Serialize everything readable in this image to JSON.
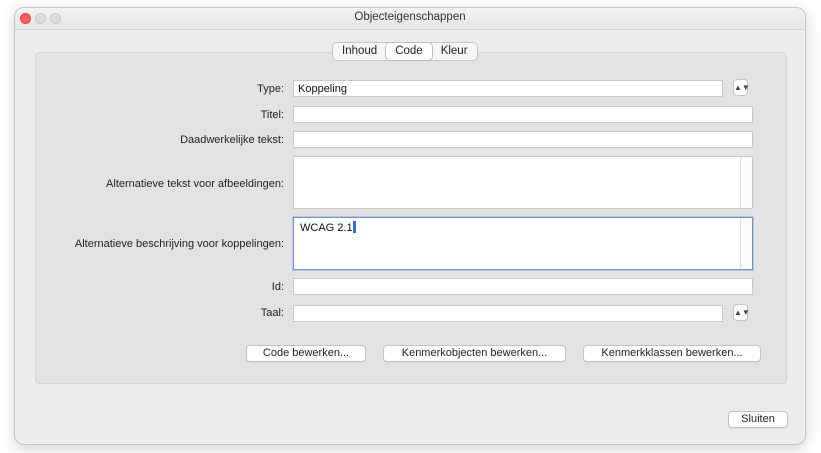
{
  "window": {
    "title": "Objecteigenschappen"
  },
  "tabs": [
    {
      "label": "Inhoud",
      "active": false
    },
    {
      "label": "Code",
      "active": true
    },
    {
      "label": "Kleur",
      "active": false
    }
  ],
  "form": {
    "type_label": "Type:",
    "type_value": "Koppeling",
    "title_label": "Titel:",
    "title_value": "",
    "actual_text_label": "Daadwerkelijke tekst:",
    "actual_text_value": "",
    "alt_text_images_label": "Alternatieve tekst voor afbeeldingen:",
    "alt_text_images_value": "",
    "alt_desc_links_label": "Alternatieve beschrijving voor koppelingen:",
    "alt_desc_links_value": "WCAG 2.1",
    "id_label": "Id:",
    "id_value": "",
    "lang_label": "Taal:",
    "lang_value": ""
  },
  "buttons": {
    "edit_code": "Code bewerken...",
    "edit_attribute_objects": "Kenmerkobjecten bewerken...",
    "edit_attribute_classes": "Kenmerkklassen bewerken...",
    "close": "Sluiten"
  }
}
